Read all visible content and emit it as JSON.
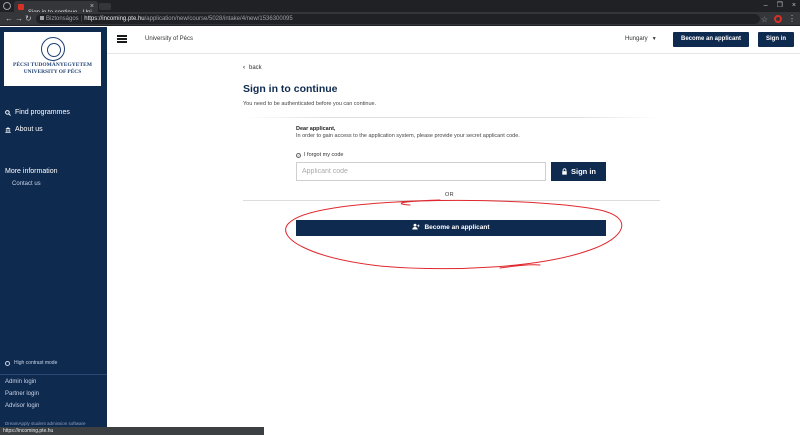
{
  "browser": {
    "tab_title": "Sign in to continue - Uni",
    "tab_close": "×",
    "window_buttons": [
      "–",
      "❐",
      "×"
    ],
    "nav": {
      "back": "←",
      "forward": "→",
      "reload": "↻"
    },
    "security_label": "Biztonságos",
    "url_host": "https://incoming.pte.hu",
    "url_path": "/application/new/course/5028/intake/4/new/1536300095",
    "star": "☆",
    "menu": "⋮"
  },
  "sidebar": {
    "logo_line1": "PÉCSI TUDOMÁNYEGYETEM",
    "logo_line2": "UNIVERSITY OF PÉCS",
    "find_programmes": "Find programmes",
    "about_us": "About us",
    "more_info_heading": "More information",
    "contact_us": "Contact us",
    "high_contrast": "High contrast mode",
    "admin_login": "Admin login",
    "partner_login": "Partner login",
    "advisor_login": "Advisor login",
    "footer": "DreamApply student admission software"
  },
  "header": {
    "title": "University of Pécs",
    "language": "Hungary",
    "become_applicant": "Become an applicant",
    "sign_in": "Sign in"
  },
  "main": {
    "back": "back",
    "title": "Sign in to continue",
    "subtitle": "You need to be authenticated before you can continue.",
    "dear": "Dear applicant,",
    "instructions": "In order to gain access to the application system, please provide your secret applicant code.",
    "forgot_code": "I forgot my code",
    "code_placeholder": "Applicant code",
    "code_value": "",
    "sign_in_button": "Sign in",
    "or": "OR",
    "become_applicant_button": "Become an applicant"
  },
  "status_bar": "https://incoming.pte.hu",
  "colors": {
    "brand_navy": "#0f2a4f",
    "annotation_red": "#e0282e",
    "browser_dark": "#202124"
  }
}
